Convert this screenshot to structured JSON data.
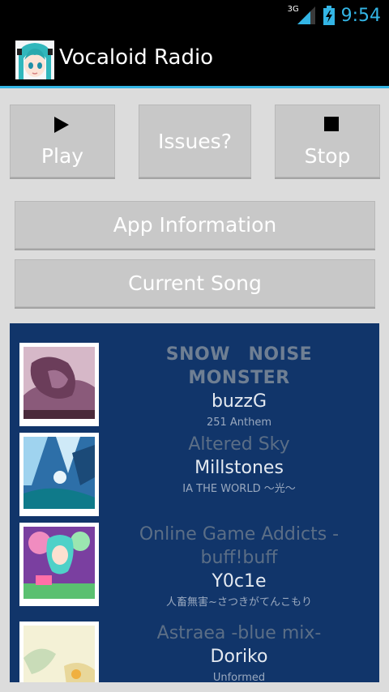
{
  "status_bar": {
    "network": "3G",
    "time": "9:54"
  },
  "action_bar": {
    "title": "Vocaloid Radio"
  },
  "controls": {
    "play_label": "Play",
    "issues_label": "Issues?",
    "stop_label": "Stop"
  },
  "menu": {
    "app_info_label": "App Information",
    "current_song_label": "Current Song"
  },
  "songs": [
    {
      "title": "SNOW　NOISE　MONSTER",
      "artist": "buzzG",
      "album": "251 Anthem"
    },
    {
      "title": "Altered Sky",
      "artist": "Millstones",
      "album": "IA THE WORLD ～光～"
    },
    {
      "title": "Online Game Addicts - buff!buff",
      "artist": "Y0c1e",
      "album": "人畜無害~さつきがてんこもり"
    },
    {
      "title": "Astraea -blue mix-",
      "artist": "Doriko",
      "album": "Unformed"
    }
  ],
  "colors": {
    "accent": "#33b5e5",
    "list_background": "#11356a",
    "button_background": "#c8c8c8"
  }
}
